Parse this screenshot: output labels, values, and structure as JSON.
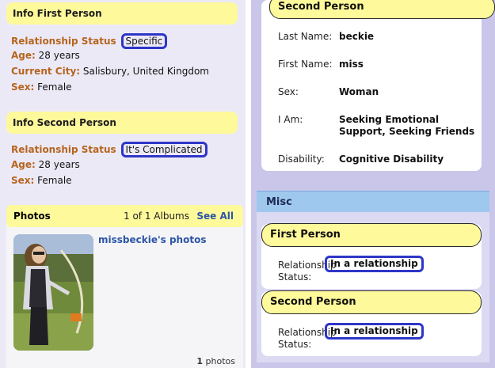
{
  "left": {
    "first_person": {
      "header": "Info First Person",
      "relationship_label": "Relationship Status",
      "relationship_value": "Specific",
      "age_label": "Age:",
      "age_value": "28 years",
      "city_label": "Current City:",
      "city_value": "Salisbury, United Kingdom",
      "sex_label": "Sex:",
      "sex_value": "Female"
    },
    "second_person": {
      "header": "Info Second Person",
      "relationship_label": "Relationship Status",
      "relationship_value": "It's Complicated",
      "age_label": "Age:",
      "age_value": "28 years",
      "sex_label": "Sex:",
      "sex_value": "Female"
    },
    "photos": {
      "header": "Photos",
      "albums_count": "1 of 1 Albums",
      "see_all": "See All",
      "album_title": "missbeckie's photos",
      "photo_count_number": "1",
      "photo_count_label": "photos"
    }
  },
  "right": {
    "second_person_card": {
      "title": "Second Person",
      "rows": [
        {
          "label": "Last Name:",
          "value": "beckie"
        },
        {
          "label": "First Name:",
          "value": "miss"
        },
        {
          "label": "Sex:",
          "value": "Woman"
        },
        {
          "label": "I Am:",
          "value": "Seeking Emotional Support, Seeking Friends"
        },
        {
          "label": "Disability:",
          "value": "Cognitive Disability"
        }
      ]
    },
    "misc": {
      "title": "Misc",
      "first_person": {
        "title": "First Person",
        "label_line1": "Relationship",
        "label_line2": "Status:",
        "value": "In a relationship"
      },
      "second_person": {
        "title": "Second Person",
        "label_line1": "Relationship",
        "label_line2": "Status:",
        "value": "In a relationship"
      }
    }
  },
  "colors": {
    "accent_yellow": "#fef99a",
    "label_orange": "#b5651d",
    "link_blue": "#2b55a5",
    "annotation_blue": "#2e36c8",
    "misc_blue": "#9fc8ee"
  }
}
